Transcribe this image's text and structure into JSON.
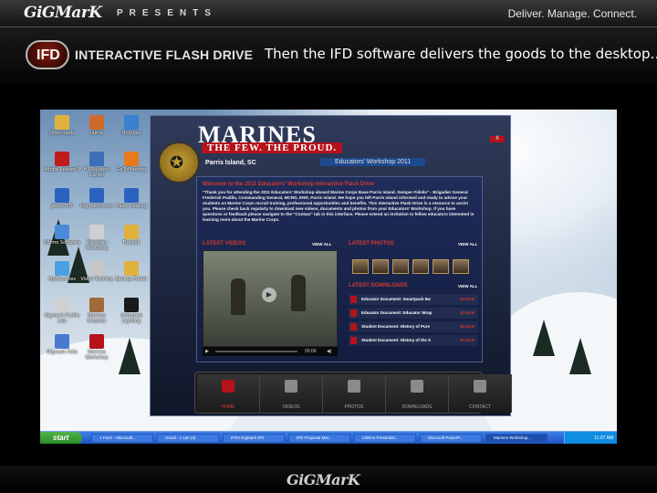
{
  "header": {
    "brand": "GiGMarK",
    "presents": "PRESENTS",
    "tagline": "Deliver.  Manage.  Connect.",
    "logo_text": "IFD",
    "product_name": "INTERACTIVE FLASH DRIVE",
    "caption": "Then the IFD software delivers the goods to the desktop…"
  },
  "desktop": {
    "icons": [
      {
        "label": "Downloads",
        "color": "#e0b23c"
      },
      {
        "label": "Jaime",
        "color": "#d06a2a"
      },
      {
        "label": "Dropbox",
        "color": "#3a7fd0"
      },
      {
        "label": "Adobe Reader 9",
        "color": "#c21b1b"
      },
      {
        "label": "HP Solution Center",
        "color": "#3c6fb8"
      },
      {
        "label": "GoToMeeting",
        "color": "#e87a1e"
      },
      {
        "label": "Jewel IFD",
        "color": "#2a62c0"
      },
      {
        "label": "GigmarkDemo",
        "color": "#2a62c0"
      },
      {
        "label": "Haier Catalog",
        "color": "#2a62c0"
      },
      {
        "label": "Ultimo Software",
        "color": "#4a8ad8"
      },
      {
        "label": "Windows Workshop",
        "color": "#d0d0d0"
      },
      {
        "label": "Firewall",
        "color": "#e0b23c"
      },
      {
        "label": "MyFavorites",
        "color": "#4aa0e0"
      },
      {
        "label": "Video Training",
        "color": "#c8c8c8"
      },
      {
        "label": "Backup Folder",
        "color": "#e0b23c"
      },
      {
        "label": "Gigmark Profile Lab",
        "color": "#d0d0d0"
      },
      {
        "label": "Marines Dropbox",
        "color": "#a06a3a"
      },
      {
        "label": "Universal Lighting",
        "color": "#1a1a1a"
      },
      {
        "label": "Gigmark Foto",
        "color": "#4a7ad0"
      },
      {
        "label": "Marines Workshop",
        "color": "#b5121b"
      }
    ],
    "taskbar": {
      "start": "start",
      "tasks": [
        "1 Form - Microsoft...",
        "Gmail - 1 Lite (6)",
        "IFD3 GigMark IFD",
        "IFD Proposal Mar...",
        "Lifeline Presentati...",
        "Microsoft PowerP...",
        "Marines Workshop..."
      ],
      "clock": "11:07 AM"
    }
  },
  "app": {
    "title": "MARINES",
    "slogan": "THE FEW. THE PROUD.",
    "close": "X",
    "location": "Parris Island, SC",
    "event": "Educators' Workshop 2011",
    "welcome_heading": "Welcome to the 2011 Educators' Workshop Interactive Flash Drive",
    "welcome_text": "\"Thank you for attending the 2011 Educators' Workshop aboard Marine Corps Base Parris Island. Semper Fidelis\" - Brigadier General Frederick Padilla, Commanding General, MCRD, ERR, Parris Island. We hope you left Parris Island informed and ready to advise your students on Marine Corps recruit training, professional opportunities and benefits. This Interactive Flash Drive is a resource to assist you. Please check back regularly to download new videos, documents and photos from your Educators' Workshop. If you have questions or feedback please navigate to the \"Contact\" tab in this interface. Please extend an invitation to fellow educators interested in learning more about the Marine Corps.",
    "latest_videos": "LATEST VIDEOS",
    "latest_photos": "LATEST PHOTOS",
    "latest_downloads": "LATEST DOWNLOADS",
    "view_all": "VIEW ALL",
    "video_time": "00:00",
    "downloads": [
      {
        "name": "Educator Document: Smartpack 6w",
        "size": "10.25 M"
      },
      {
        "name": "Educator Document: Educator Wrap",
        "size": "10.25 M"
      },
      {
        "name": "Student Document: History of Pure",
        "size": "10.25 M"
      },
      {
        "name": "Student Document: History of the S",
        "size": "10.25 M"
      }
    ],
    "nav": [
      "HOME",
      "VIDEOS",
      "PHOTOS",
      "DOWNLOADS",
      "CONTACT"
    ]
  },
  "footer": {
    "brand": "GiGMarK"
  }
}
